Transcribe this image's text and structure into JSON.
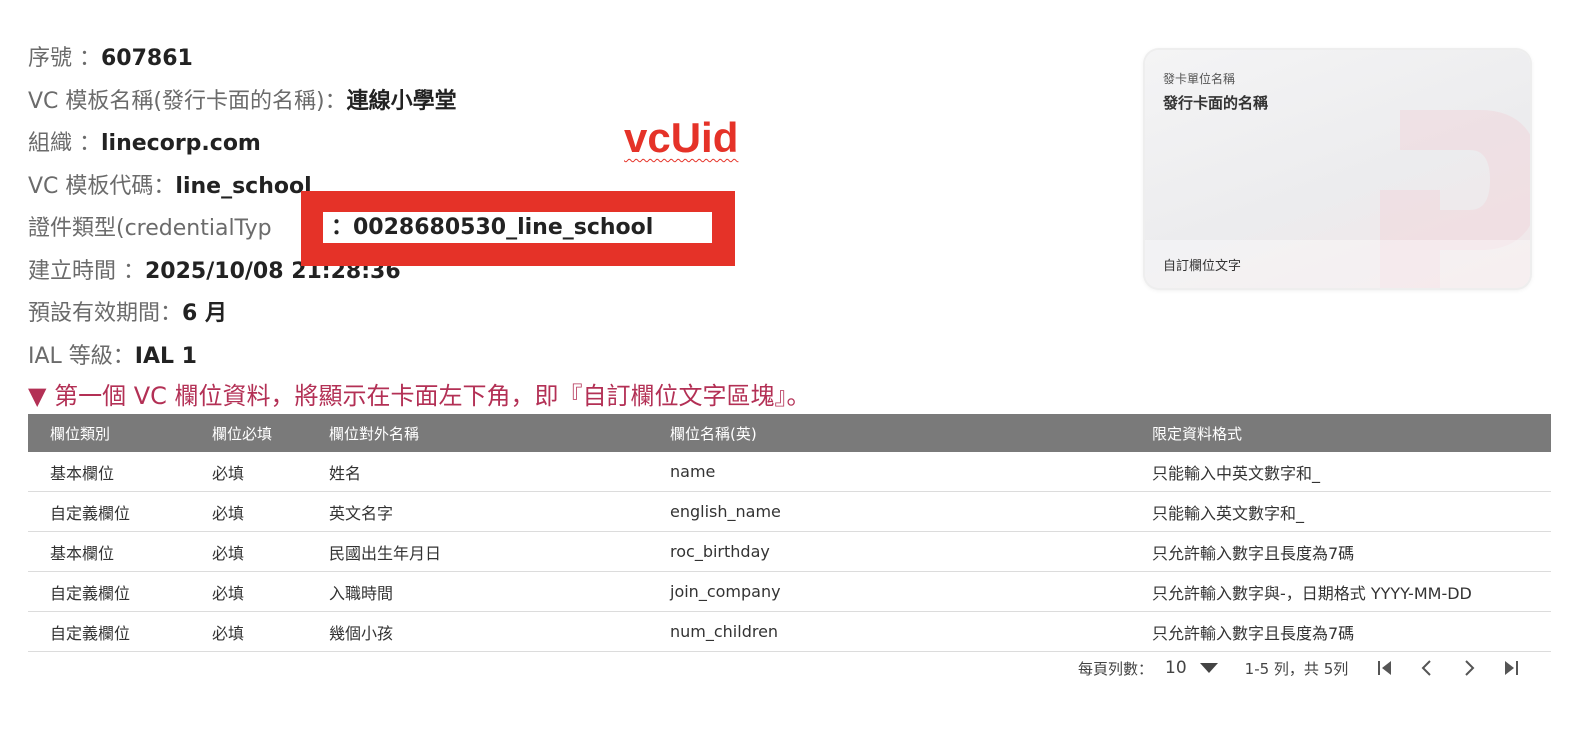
{
  "info": [
    {
      "label": "序號 ：",
      "value": "607861"
    },
    {
      "label": "VC 模板名稱(發行卡面的名稱)：",
      "value": "連線小學堂"
    },
    {
      "label": "組織 ：",
      "value": "linecorp.com"
    },
    {
      "label": "VC 模板代碼：",
      "value": "line_school"
    },
    {
      "label": "證件類型(credentialTyp",
      "value": ""
    },
    {
      "label": "建立時間 ：",
      "value": "2025/10/08 21:28:36"
    },
    {
      "label": "預設有效期間：",
      "value": "6 月"
    },
    {
      "label": "IAL 等級：",
      "value": "IAL 1"
    }
  ],
  "annotation": {
    "label": "vcUid",
    "value": "：0028680530_line_school",
    "color": "#e53228"
  },
  "card": {
    "issuer_label": "發卡單位名稱",
    "name": "發行卡面的名稱",
    "custom_text": "自訂欄位文字"
  },
  "section_heading": "▼ 第一個 VC 欄位資料，將顯示在卡面左下角，即『自訂欄位文字區塊』。",
  "table": {
    "headers": [
      "欄位類別",
      "欄位必填",
      "欄位對外名稱",
      "欄位名稱(英)",
      "限定資料格式"
    ],
    "rows": [
      [
        "基本欄位",
        "必填",
        "姓名",
        "name",
        "只能輸入中英文數字和_"
      ],
      [
        "自定義欄位",
        "必填",
        "英文名字",
        "english_name",
        "只能輸入英文數字和_"
      ],
      [
        "基本欄位",
        "必填",
        "民國出生年月日",
        "roc_birthday",
        "只允許輸入數字且長度為7碼"
      ],
      [
        "自定義欄位",
        "必填",
        "入職時間",
        "join_company",
        "只允許輸入數字與-，日期格式 YYYY-MM-DD"
      ],
      [
        "自定義欄位",
        "必填",
        "幾個小孩",
        "num_children",
        "只允許輸入數字且長度為7碼"
      ]
    ]
  },
  "pagination": {
    "rows_per_page_label": "每頁列數：",
    "rows_per_page": "10",
    "range": "1-5 列，共 5列"
  },
  "colors": {
    "accent_red": "#e53228",
    "heading": "#b33055",
    "table_header": "#7a7a7a"
  }
}
